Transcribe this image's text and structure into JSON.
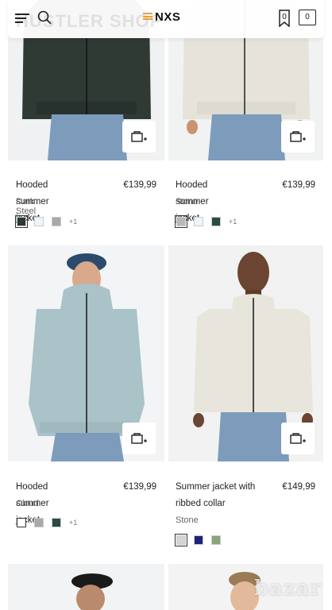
{
  "header": {
    "watermark": "HUSTLER SHOP",
    "logo": "NXS",
    "wishlist_count": "0",
    "cart_count": "0"
  },
  "products": [
    {
      "name": "Hooded summer jacket",
      "price": "€139,99",
      "color": "Dark Steel",
      "swatches": [
        "#2c3a35",
        "#eef4fb",
        "#a9a9a9"
      ],
      "more": "+1",
      "jacket": "#2f3a35"
    },
    {
      "name": "Hooded summer jacket",
      "price": "€139,99",
      "color": "Stone",
      "swatches": [
        "#b9b9b9",
        "#eef4fb",
        "#2c4a45"
      ],
      "more": "+1",
      "jacket": "#e5e3da"
    },
    {
      "name": "Hooded summer jacket",
      "price": "€139,99",
      "color": "Cloud",
      "swatches": [
        "#ffffff",
        "#a9a9a9",
        "#2c4a45"
      ],
      "more": "+1",
      "jacket": "#a9c3c8"
    },
    {
      "name": "Summer jacket with ribbed collar",
      "price": "€149,99",
      "color": "Stone",
      "swatches": [
        "#d4d4d4",
        "#1f2278",
        "#8ca47a"
      ],
      "more": "",
      "jacket": "#e7e5dc"
    }
  ],
  "footer_watermark": "bazar"
}
